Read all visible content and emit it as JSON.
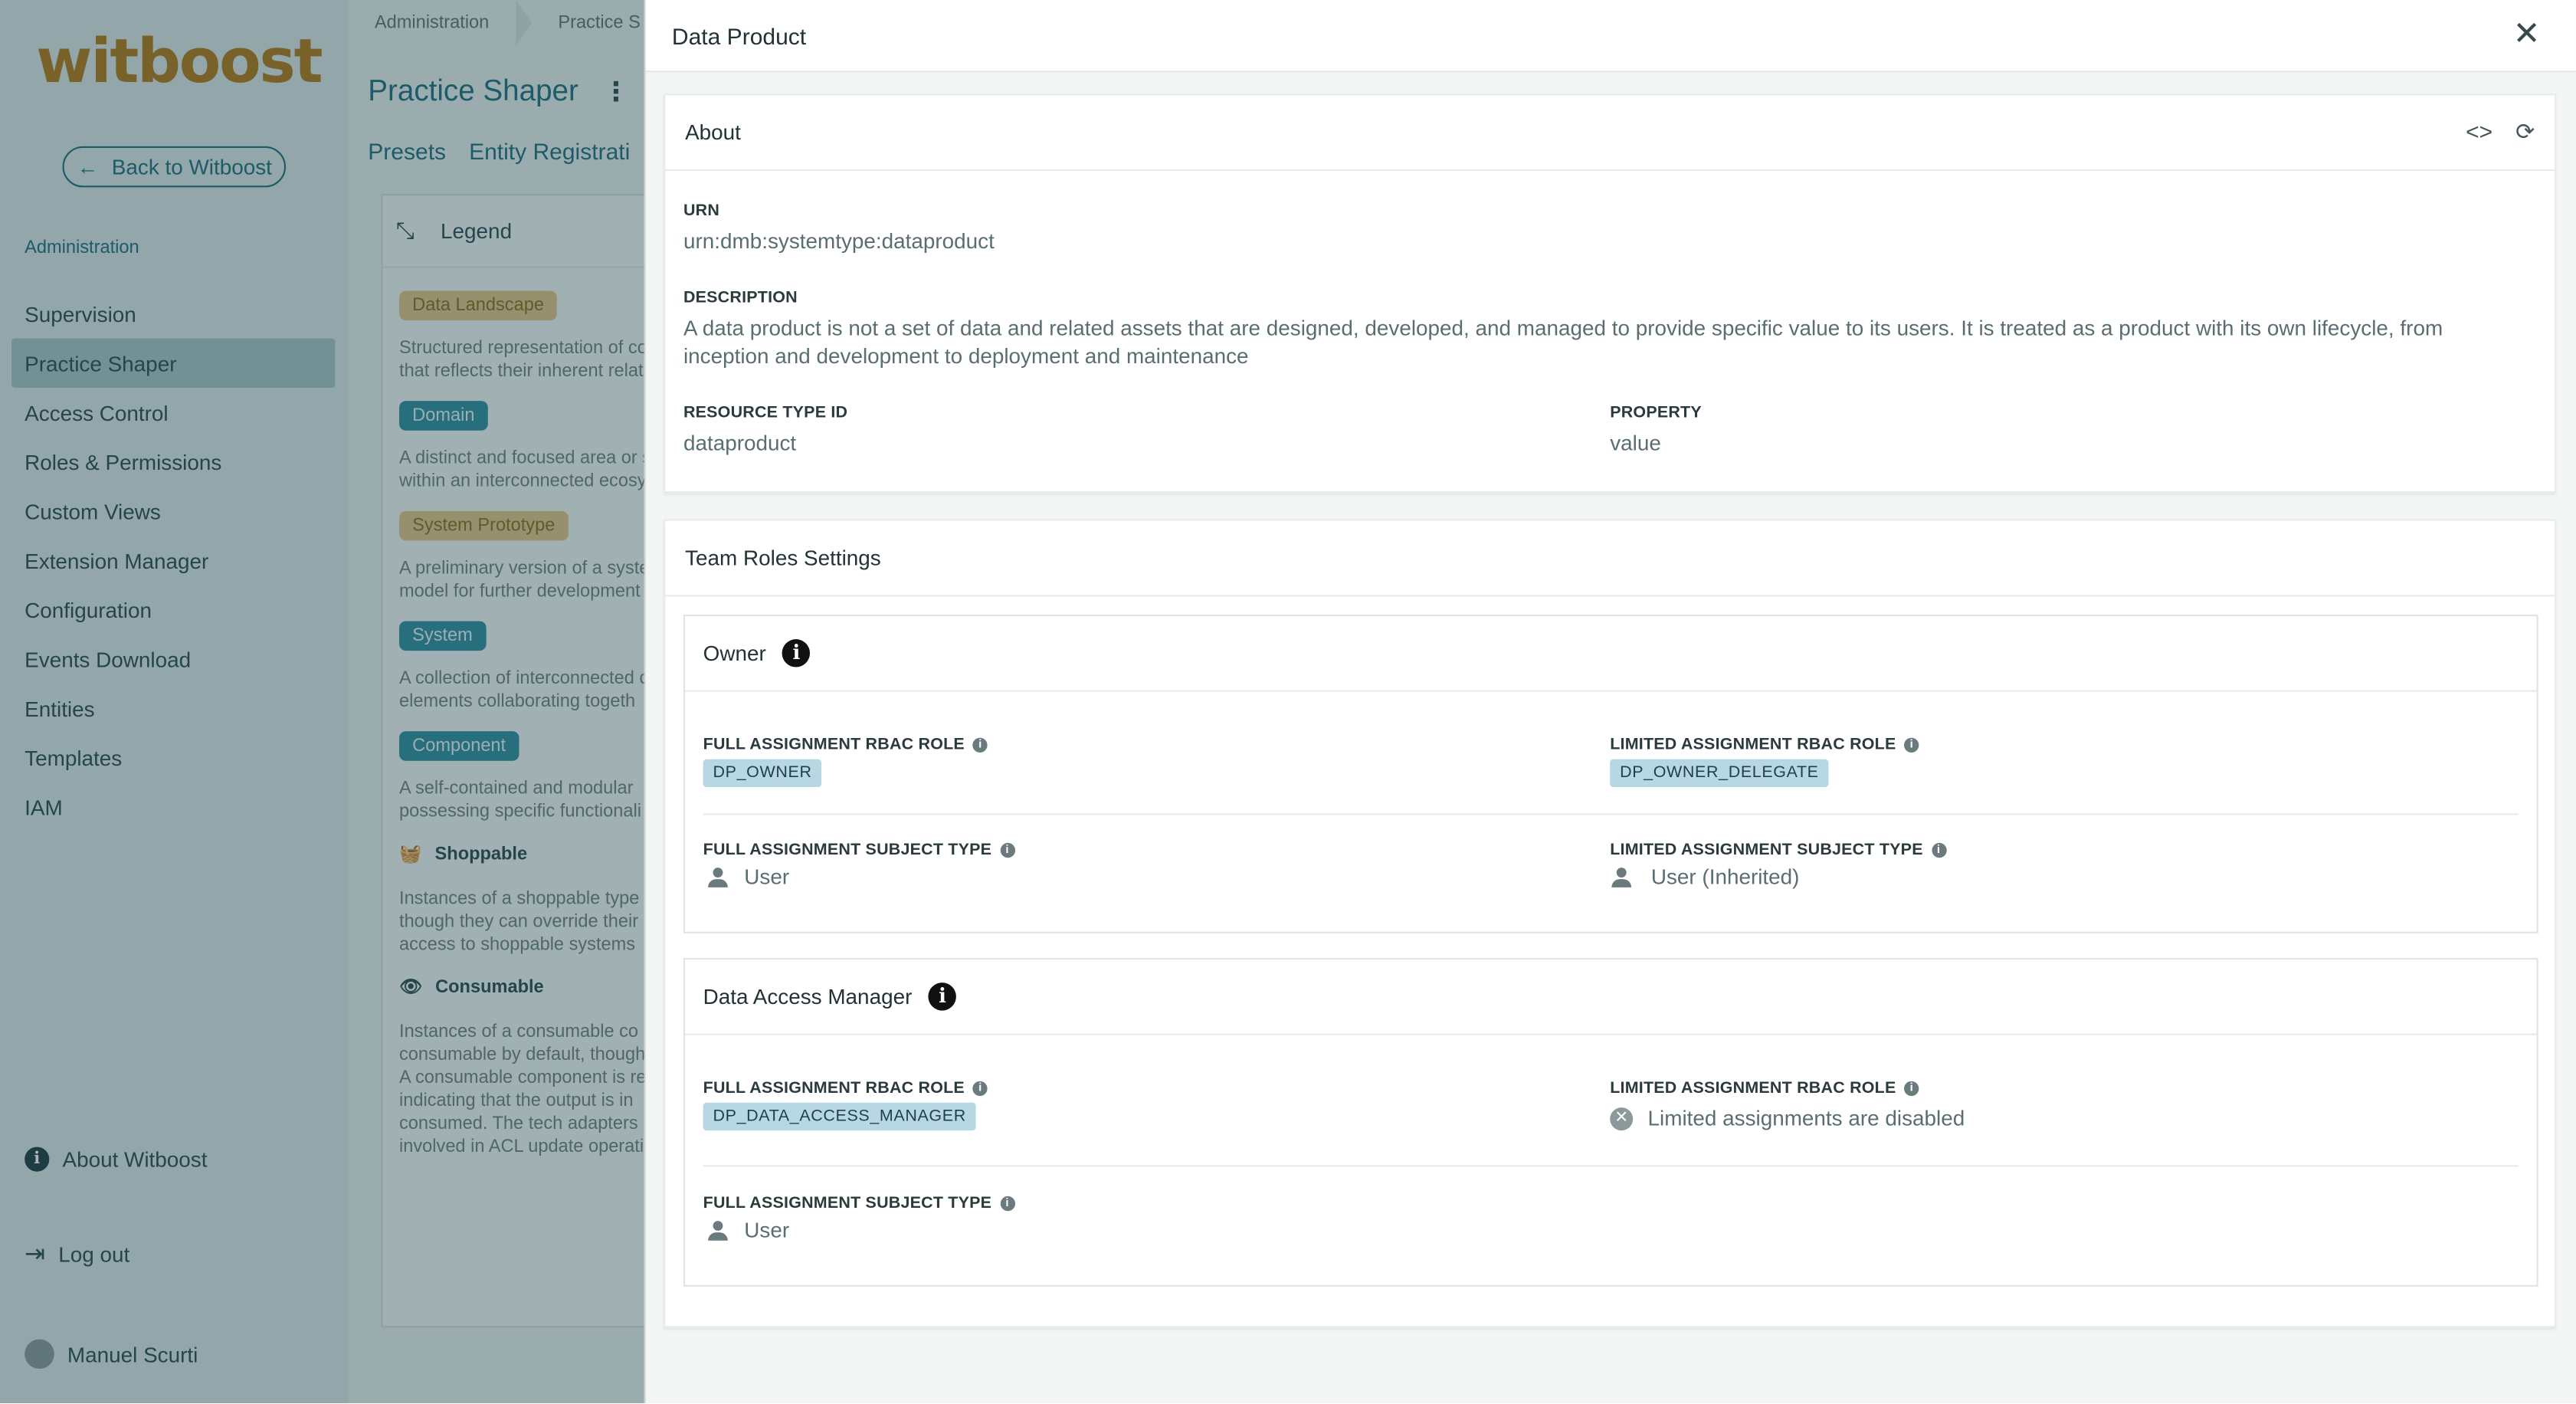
{
  "sidebar": {
    "logo": "witboost",
    "back_label": "Back to Witboost",
    "section_label": "Administration",
    "items": [
      "Supervision",
      "Practice Shaper",
      "Access Control",
      "Roles & Permissions",
      "Custom Views",
      "Extension Manager",
      "Configuration",
      "Events Download",
      "Entities",
      "Templates",
      "IAM"
    ],
    "active_item": "Practice Shaper",
    "about_label": "About Witboost",
    "logout_label": "Log out",
    "user_name": "Manuel Scurti"
  },
  "background": {
    "breadcrumb": [
      "Administration",
      "Practice S"
    ],
    "title": "Practice Shaper",
    "tabs": [
      "Presets",
      "Entity Registrati"
    ],
    "legend_title": "Legend",
    "legend": [
      {
        "chip": "Data Landscape",
        "style": "amber",
        "desc": [
          "Structured representation of co",
          "that reflects their inherent relat"
        ]
      },
      {
        "chip": "Domain",
        "style": "teal",
        "desc": [
          "A distinct and focused area or s",
          "within an interconnected ecosy"
        ]
      },
      {
        "chip": "System Prototype",
        "style": "amber",
        "desc": [
          "A preliminary version of a syste",
          "model for further development"
        ]
      },
      {
        "chip": "System",
        "style": "teal",
        "desc": [
          "A collection of interconnected c",
          "elements collaborating togeth"
        ]
      },
      {
        "chip": "Component",
        "style": "teal",
        "desc": [
          "A self-contained and modular",
          "possessing specific functionali"
        ]
      }
    ],
    "shoppable_label": "Shoppable",
    "shoppable_desc": [
      "Instances of a shoppable type",
      "though they can override their",
      "access to shoppable systems"
    ],
    "consumable_label": "Consumable",
    "consumable_desc": [
      "Instances of a consumable co",
      "consumable by default, though",
      "A consumable component is re",
      "indicating that the output is in",
      "consumed. The tech adapters",
      "involved in ACL update operati"
    ]
  },
  "drawer": {
    "title": "Data Product",
    "about": {
      "title": "About",
      "urn_label": "URN",
      "urn_value": "urn:dmb:systemtype:dataproduct",
      "description_label": "DESCRIPTION",
      "description_value": "A data product is not a set of data and related assets that are designed, developed, and managed to provide specific value to its users. It is treated as a product with its own lifecycle, from inception and development to deployment and maintenance",
      "resource_type_label": "RESOURCE TYPE ID",
      "resource_type_value": "dataproduct",
      "property_label": "PROPERTY",
      "property_value": "value"
    },
    "team_roles": {
      "title": "Team Roles Settings",
      "owner": {
        "title": "Owner",
        "full_role_label": "FULL ASSIGNMENT RBAC ROLE",
        "full_role_value": "DP_OWNER",
        "limited_role_label": "LIMITED ASSIGNMENT RBAC ROLE",
        "limited_role_value": "DP_OWNER_DELEGATE",
        "full_subject_label": "FULL ASSIGNMENT SUBJECT TYPE",
        "full_subject_value": "User",
        "limited_subject_label": "LIMITED ASSIGNMENT SUBJECT TYPE",
        "limited_subject_value": "User (Inherited)"
      },
      "data_access_manager": {
        "title": "Data Access Manager",
        "full_role_label": "FULL ASSIGNMENT RBAC ROLE",
        "full_role_value": "DP_DATA_ACCESS_MANAGER",
        "limited_role_label": "LIMITED ASSIGNMENT RBAC ROLE",
        "limited_role_value": "Limited assignments are disabled",
        "full_subject_label": "FULL ASSIGNMENT SUBJECT TYPE",
        "full_subject_value": "User"
      }
    }
  }
}
